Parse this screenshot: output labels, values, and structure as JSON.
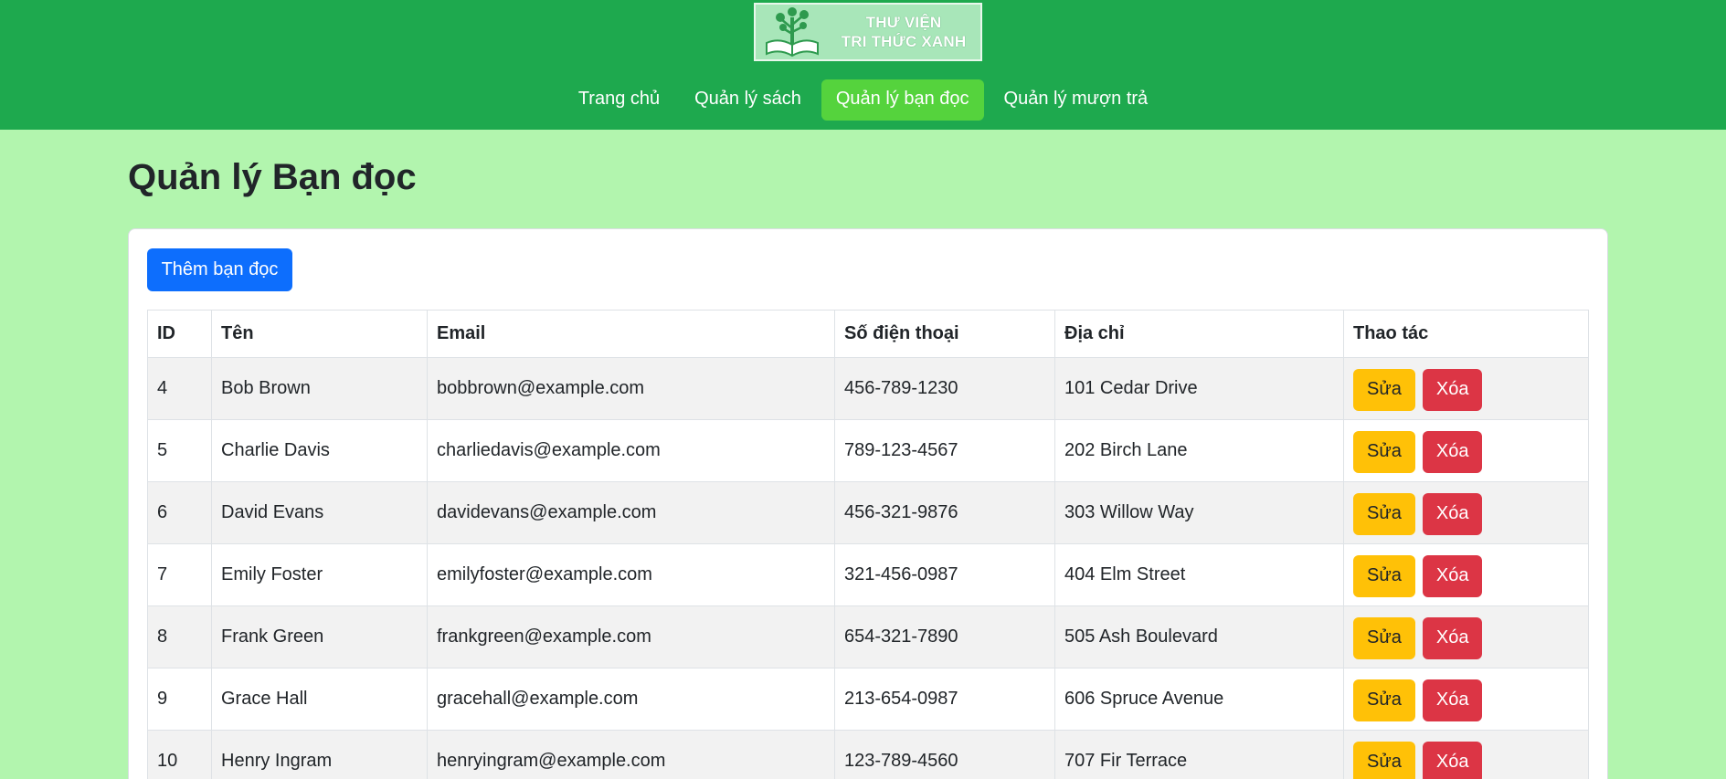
{
  "brand": {
    "line1": "THƯ VIỆN",
    "line2": "TRI THỨC XANH"
  },
  "nav": [
    {
      "label": "Trang chủ",
      "active": false
    },
    {
      "label": "Quản lý sách",
      "active": false
    },
    {
      "label": "Quản lý bạn đọc",
      "active": true
    },
    {
      "label": "Quản lý mượn trả",
      "active": false
    }
  ],
  "page": {
    "title": "Quản lý Bạn đọc",
    "add_button": "Thêm bạn đọc"
  },
  "table": {
    "headers": [
      "ID",
      "Tên",
      "Email",
      "Số điện thoại",
      "Địa chỉ",
      "Thao tác"
    ],
    "edit_label": "Sửa",
    "delete_label": "Xóa",
    "rows": [
      {
        "id": "4",
        "name": "Bob Brown",
        "email": "bobbrown@example.com",
        "phone": "456-789-1230",
        "address": "101 Cedar Drive"
      },
      {
        "id": "5",
        "name": "Charlie Davis",
        "email": "charliedavis@example.com",
        "phone": "789-123-4567",
        "address": "202 Birch Lane"
      },
      {
        "id": "6",
        "name": "David Evans",
        "email": "davidevans@example.com",
        "phone": "456-321-9876",
        "address": "303 Willow Way"
      },
      {
        "id": "7",
        "name": "Emily Foster",
        "email": "emilyfoster@example.com",
        "phone": "321-456-0987",
        "address": "404 Elm Street"
      },
      {
        "id": "8",
        "name": "Frank Green",
        "email": "frankgreen@example.com",
        "phone": "654-321-7890",
        "address": "505 Ash Boulevard"
      },
      {
        "id": "9",
        "name": "Grace Hall",
        "email": "gracehall@example.com",
        "phone": "213-654-0987",
        "address": "606 Spruce Avenue"
      },
      {
        "id": "10",
        "name": "Henry Ingram",
        "email": "henryingram@example.com",
        "phone": "123-789-4560",
        "address": "707 Fir Terrace"
      }
    ]
  },
  "colors": {
    "header": "#1ea94e",
    "page_bg": "#b2f5ae",
    "nav_active": "#55d33d",
    "primary": "#0d6efd",
    "warning": "#ffc107",
    "danger": "#dc3545"
  }
}
